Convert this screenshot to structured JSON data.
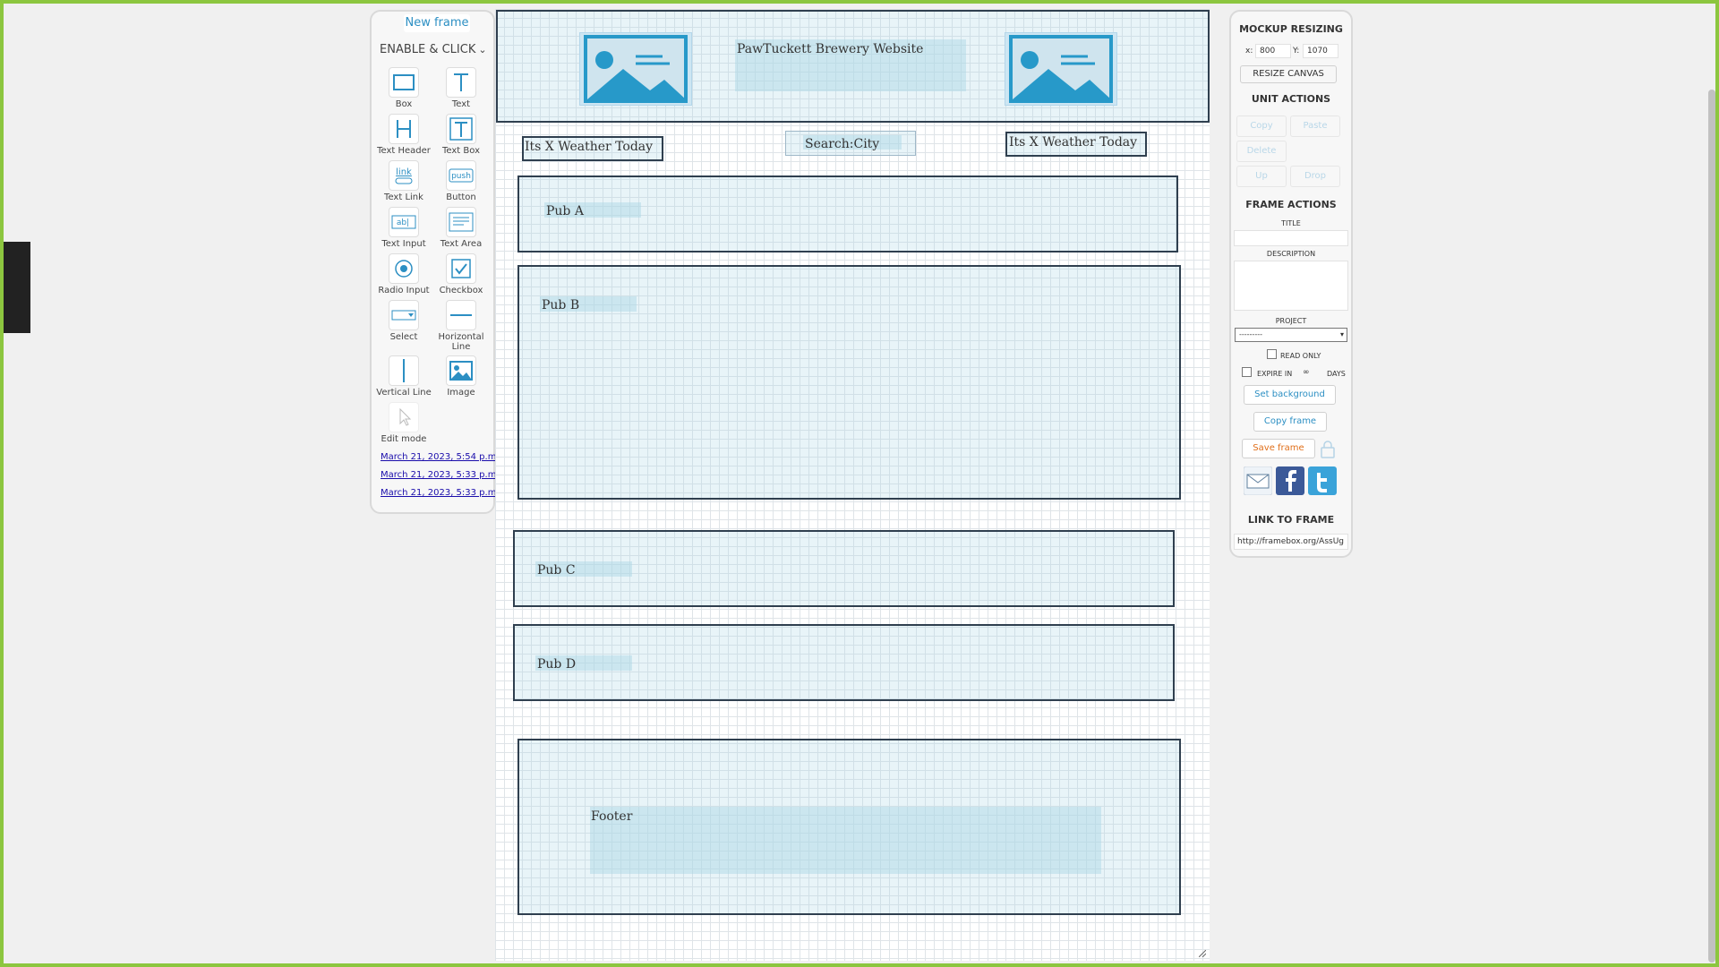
{
  "tools_panel": {
    "new_frame": "New frame",
    "mode": "ENABLE & CLICK",
    "tools": [
      {
        "label": "Box"
      },
      {
        "label": "Text"
      },
      {
        "label": "Text Header"
      },
      {
        "label": "Text Box"
      },
      {
        "label": "Text Link"
      },
      {
        "label": "Button"
      },
      {
        "label": "Text Input"
      },
      {
        "label": "Text Area"
      },
      {
        "label": "Radio Input"
      },
      {
        "label": "Checkbox"
      },
      {
        "label": "Select"
      },
      {
        "label": "Horizontal Line"
      },
      {
        "label": "Vertical Line"
      },
      {
        "label": "Image"
      },
      {
        "label": "Edit mode"
      }
    ],
    "icon_glyphs": {
      "text_link": "link",
      "button": "push",
      "text_input": "ab|"
    },
    "history": [
      "March 21, 2023, 5:54 p.m.",
      "March 21, 2023, 5:33 p.m.",
      "March 21, 2023, 5:33 p.m."
    ]
  },
  "canvas": {
    "header_title": "PawTuckett Brewery Website",
    "weather_left": "Its X Weather Today",
    "search": "Search:City",
    "weather_right": "Its X Weather Today",
    "pubs": [
      "Pub A",
      "Pub B",
      "Pub C",
      "Pub D"
    ],
    "footer": "Footer"
  },
  "right_panel": {
    "mockup_resizing": "MOCKUP RESIZING",
    "x_label": "x:",
    "x_value": "800",
    "y_label": "Y:",
    "y_value": "1070",
    "resize_canvas": "RESIZE CANVAS",
    "unit_actions": "UNIT ACTIONS",
    "copy": "Copy",
    "paste": "Paste",
    "delete": "Delete",
    "up": "Up",
    "drop": "Drop",
    "frame_actions": "FRAME ACTIONS",
    "title_label": "TITLE",
    "description_label": "DESCRIPTION",
    "project_label": "PROJECT",
    "project_value": "---------",
    "read_only": "READ ONLY",
    "expire_in": "EXPIRE IN",
    "expire_days_value": "∞",
    "days": "DAYS",
    "set_background": "Set background",
    "copy_frame": "Copy frame",
    "save_frame": "Save frame",
    "link_to_frame": "LINK TO FRAME",
    "link_value": "http://framebox.org/AssUg"
  },
  "colors": {
    "accent": "#2c8fc3",
    "frame_border": "#8cc63f",
    "save": "#e06f1a"
  }
}
